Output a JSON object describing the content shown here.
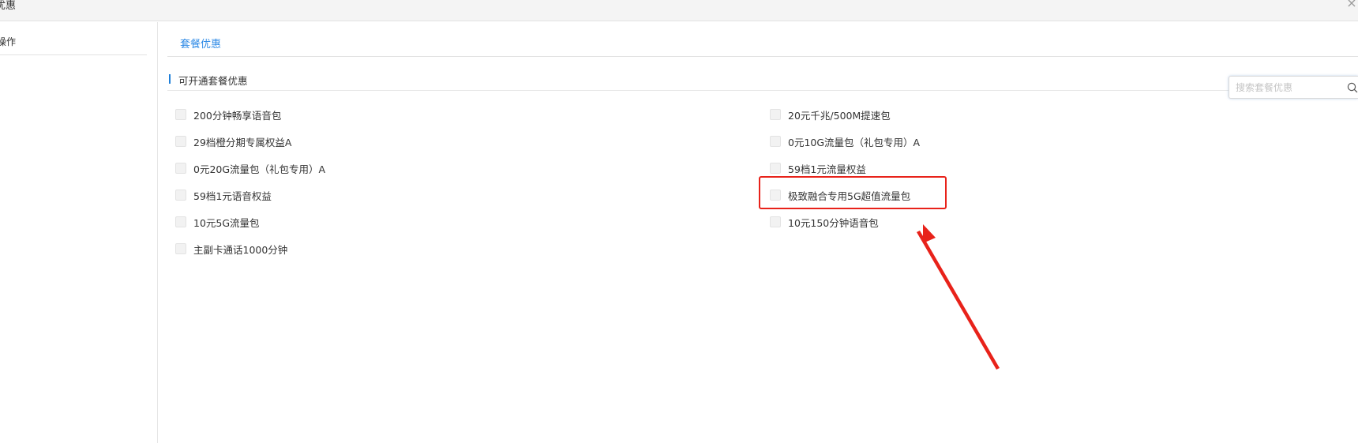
{
  "window": {
    "title": "优惠",
    "close_label": "×"
  },
  "sidebar": {
    "item_label": "操作"
  },
  "tabs": [
    {
      "label": "套餐优惠"
    }
  ],
  "section": {
    "title": "可开通套餐优惠"
  },
  "search": {
    "placeholder": "搜索套餐优惠",
    "value": "",
    "icon": "search-icon"
  },
  "options_left": [
    {
      "label": "200分钟畅享语音包",
      "checked": false
    },
    {
      "label": "29档橙分期专属权益A",
      "checked": false
    },
    {
      "label": "0元20G流量包（礼包专用）A",
      "checked": false
    },
    {
      "label": "59档1元语音权益",
      "checked": false
    },
    {
      "label": "10元5G流量包",
      "checked": false
    },
    {
      "label": "主副卡通话1000分钟",
      "checked": false
    }
  ],
  "options_right": [
    {
      "label": "20元千兆/500M提速包",
      "checked": false
    },
    {
      "label": "0元10G流量包（礼包专用）A",
      "checked": false
    },
    {
      "label": "59档1元流量权益",
      "checked": false
    },
    {
      "label": "极致融合专用5G超值流量包",
      "checked": false,
      "highlighted": true
    },
    {
      "label": "10元150分钟语音包",
      "checked": false
    }
  ],
  "annotation": {
    "color": "#e8221a"
  }
}
